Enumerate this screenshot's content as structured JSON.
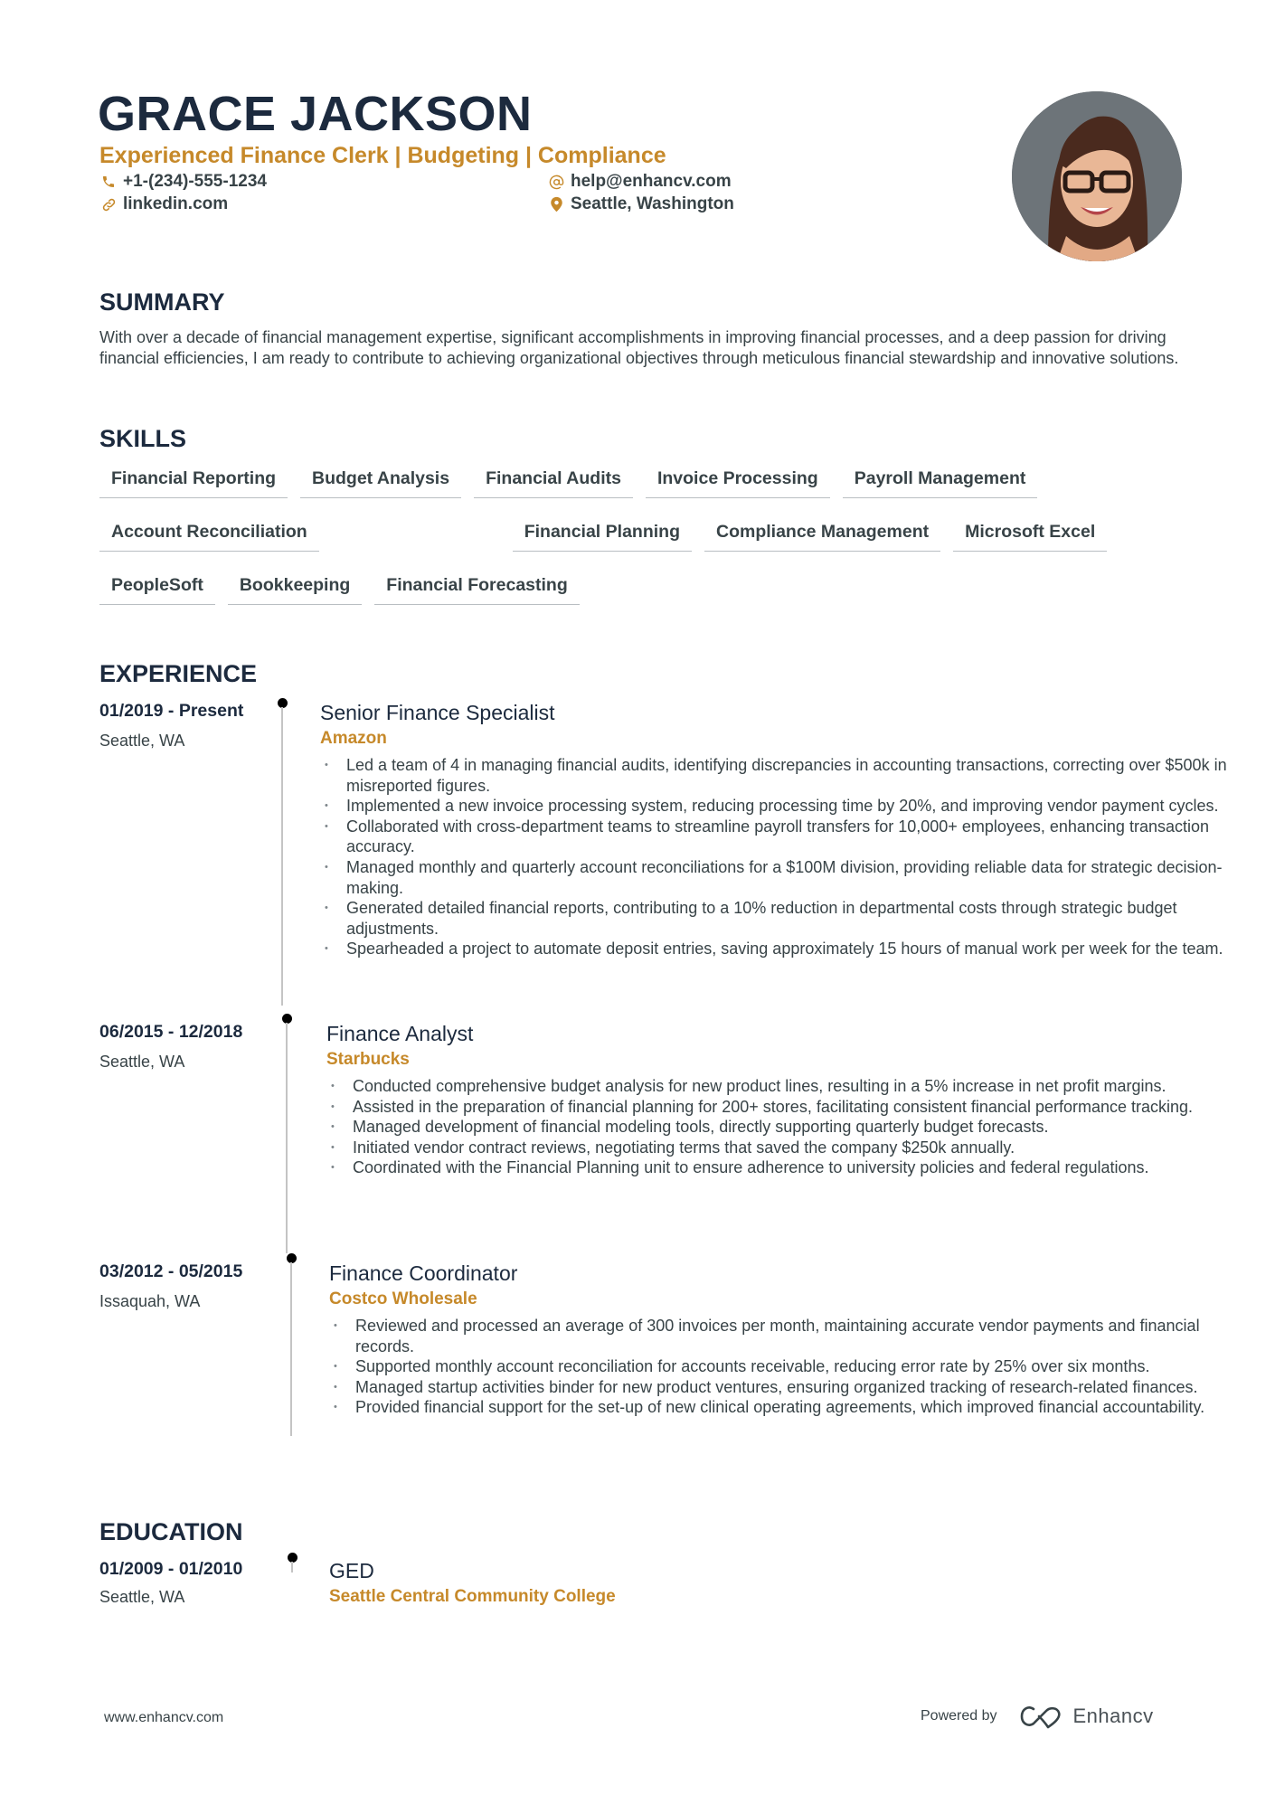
{
  "header": {
    "name": "GRACE JACKSON",
    "headline": "Experienced Finance Clerk | Budgeting | Compliance",
    "contacts": {
      "phone": {
        "icon": "phone-icon",
        "text": "+1-(234)-555-1234"
      },
      "linkedin": {
        "icon": "link-icon",
        "text": "linkedin.com"
      },
      "email": {
        "icon": "at-icon",
        "text": "help@enhancv.com"
      },
      "location": {
        "icon": "location-pin-icon",
        "text": "Seattle, Washington"
      }
    },
    "photo_alt": "profile photo"
  },
  "summary": {
    "title": "SUMMARY",
    "text": "With over a decade of financial management expertise, significant accomplishments in improving financial processes, and a deep passion for driving financial efficiencies, I am ready to contribute to achieving organizational objectives through meticulous financial stewardship and innovative solutions."
  },
  "skills": {
    "title": "SKILLS",
    "items": [
      "Financial Reporting",
      "Budget Analysis",
      "Financial Audits",
      "Invoice Processing",
      "Payroll Management",
      "Account Reconciliation",
      "Financial Planning",
      "Compliance Management",
      "Microsoft Excel",
      "PeopleSoft",
      "Bookkeeping",
      "Financial Forecasting"
    ]
  },
  "experience": {
    "title": "EXPERIENCE",
    "entries": [
      {
        "date": "01/2019 - Present",
        "location": "Seattle, WA",
        "role": "Senior Finance Specialist",
        "company": "Amazon",
        "bullets": [
          "Led a team of 4 in managing financial audits, identifying discrepancies in accounting transactions, correcting over $500k in misreported figures.",
          "Implemented a new invoice processing system, reducing processing time by 20%, and improving vendor payment cycles.",
          "Collaborated with cross-department teams to streamline payroll transfers for 10,000+ employees, enhancing transaction accuracy.",
          "Managed monthly and quarterly account reconciliations for a $100M division, providing reliable data for strategic decision-making.",
          "Generated detailed financial reports, contributing to a 10% reduction in departmental costs through strategic budget adjustments.",
          "Spearheaded a project to automate deposit entries, saving approximately 15 hours of manual work per week for the team."
        ]
      },
      {
        "date": "06/2015 - 12/2018",
        "location": "Seattle, WA",
        "role": "Finance Analyst",
        "company": "Starbucks",
        "bullets": [
          "Conducted comprehensive budget analysis for new product lines, resulting in a 5% increase in net profit margins.",
          "Assisted in the preparation of financial planning for 200+ stores, facilitating consistent financial performance tracking.",
          "Managed development of financial modeling tools, directly supporting quarterly budget forecasts.",
          "Initiated vendor contract reviews, negotiating terms that saved the company $250k annually.",
          "Coordinated with the Financial Planning unit to ensure adherence to university policies and federal regulations."
        ]
      },
      {
        "date": "03/2012 - 05/2015",
        "location": "Issaquah, WA",
        "role": "Finance Coordinator",
        "company": "Costco Wholesale",
        "bullets": [
          "Reviewed and processed an average of 300 invoices per month, maintaining accurate vendor payments and financial records.",
          "Supported monthly account reconciliation for accounts receivable, reducing error rate by 25% over six months.",
          "Managed startup activities binder for new product ventures, ensuring organized tracking of research-related finances.",
          "Provided financial support for the set-up of new clinical operating agreements, which improved financial accountability."
        ]
      }
    ]
  },
  "education": {
    "title": "EDUCATION",
    "entries": [
      {
        "date": "01/2009 - 01/2010",
        "location": "Seattle, WA",
        "degree": "GED",
        "school": "Seattle Central Community College"
      }
    ]
  },
  "footer": {
    "website": "www.enhancv.com",
    "powered_by": "Powered by",
    "brand": "Enhancv",
    "brand_icon": "enhancv-logo-icon"
  },
  "colors": {
    "accent": "#c6892a",
    "heading": "#1c2a3e",
    "body_text": "#384347",
    "timeline": "#c4c4c4"
  }
}
